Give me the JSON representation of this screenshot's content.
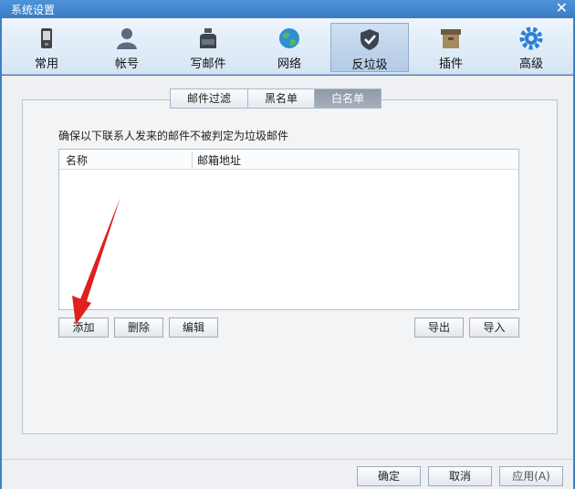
{
  "window": {
    "title": "系统设置",
    "close_glyph": "✕"
  },
  "toolbar": {
    "items": [
      {
        "label": "常用",
        "icon": "phone-icon"
      },
      {
        "label": "帐号",
        "icon": "user-icon"
      },
      {
        "label": "写邮件",
        "icon": "inkwell-icon"
      },
      {
        "label": "网络",
        "icon": "globe-icon"
      },
      {
        "label": "反垃圾",
        "icon": "shield-icon"
      },
      {
        "label": "插件",
        "icon": "box-icon"
      },
      {
        "label": "高级",
        "icon": "gear-icon"
      }
    ],
    "active_index": 4
  },
  "tabs": [
    "邮件过滤",
    "黑名单",
    "白名单"
  ],
  "active_tab": "白名单",
  "description": "确保以下联系人发来的邮件不被判定为垃圾邮件",
  "list": {
    "columns": [
      "名称",
      "邮箱地址"
    ],
    "rows": []
  },
  "list_buttons": {
    "add": "添加",
    "delete": "删除",
    "edit": "编辑",
    "export": "导出",
    "import": "导入"
  },
  "footer": {
    "ok": "确定",
    "cancel": "取消",
    "apply": "应用(A)"
  },
  "colors": {
    "titlebar": "#3a7cc4",
    "active_tab": "#9aa4b0",
    "arrow": "#e0201e"
  }
}
